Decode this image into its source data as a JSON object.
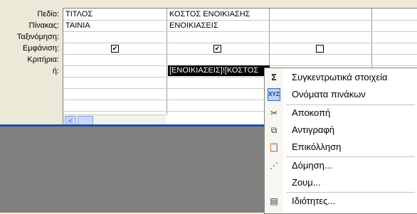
{
  "row_labels": [
    "Πεδίο:",
    "Πίνακας:",
    "Ταξινόμηση:",
    "Εμφάνιση:",
    "Κριτήρια:",
    "ή:"
  ],
  "columns": [
    {
      "field": "ΤΙΤΛΟΣ",
      "table": "ΤΑΙΝΙΑ",
      "show": true
    },
    {
      "field": "ΚΟΣΤΟΣ ΕΝΟΙΚΙΑΣΗΣ",
      "table": "ΕΝΟΙΚΙΑΣΕΙΣ",
      "show": true,
      "criteria": "[ΕΝΟΙΚΙΑΣΕΙΣ]![ΚΟΣΤΟΣ"
    },
    {
      "field": "",
      "table": "",
      "show": false
    }
  ],
  "scrollbar": {
    "left_arrow": "<"
  },
  "context_menu": {
    "items": [
      {
        "label": "Συγκεντρωτικά στοιχεία",
        "icon": "sigma-icon",
        "glyph": "Σ"
      },
      {
        "label": "Ονόματα πινάκων",
        "icon": "table-names-icon",
        "glyph": "XYZ"
      },
      {
        "label": "Αποκοπή",
        "icon": "scissors-icon",
        "glyph": "✂"
      },
      {
        "label": "Αντιγραφή",
        "icon": "copy-icon",
        "glyph": "⧉"
      },
      {
        "label": "Επικόλληση",
        "icon": "paste-icon",
        "glyph": "📋"
      },
      {
        "label": "Δόμηση...",
        "icon": "build-wand-icon",
        "glyph": "⋰"
      },
      {
        "label": "Ζουμ...",
        "icon": "",
        "glyph": ""
      },
      {
        "label": "Ιδιότητες...",
        "icon": "properties-icon",
        "glyph": "▤"
      }
    ]
  },
  "colors": {
    "selection": "#000000",
    "menu_highlight_border": "#316ac5",
    "divider": "#1f4fa8",
    "backdrop": "#808080"
  }
}
